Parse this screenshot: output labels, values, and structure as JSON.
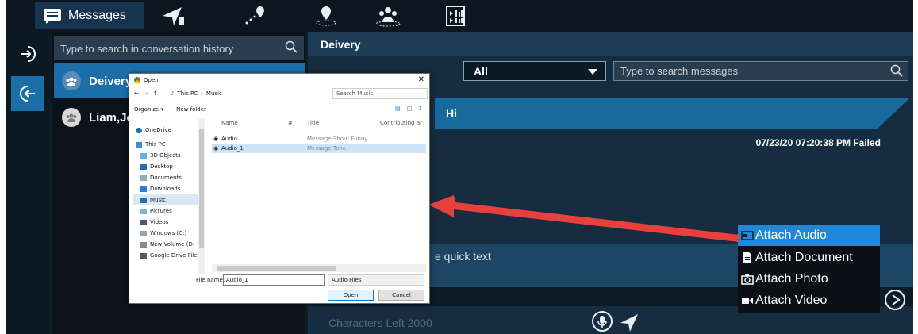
{
  "topbar": {
    "messages_tab_label": "Messages",
    "icons": [
      "message-icon",
      "location-arrow-icon",
      "route-icon",
      "geofence-icon",
      "group-icon",
      "media-icon"
    ]
  },
  "conversations": {
    "search_placeholder": "Type to search in conversation history",
    "items": [
      {
        "label": "Deivery",
        "active": true
      },
      {
        "label": "Liam,Joh",
        "active": false
      }
    ]
  },
  "chat": {
    "title": "Deivery",
    "filter_value": "All",
    "search_placeholder": "Type to search messages",
    "message_text": "Hi",
    "message_status": "07/23/20 07:20:38 PM Failed",
    "quick_text_placeholder": "e quick text",
    "characters_left": "Characters Left 2000"
  },
  "attach_menu": {
    "items": [
      {
        "label": "Attach Audio",
        "icon": "audio-file-icon",
        "active": true
      },
      {
        "label": "Attach Document",
        "icon": "document-icon",
        "active": false
      },
      {
        "label": "Attach Photo",
        "icon": "camera-icon",
        "active": false
      },
      {
        "label": "Attach Video",
        "icon": "video-icon",
        "active": false
      }
    ]
  },
  "dialog": {
    "title": "Open",
    "close": "✕",
    "breadcrumb": [
      "This PC",
      "Music"
    ],
    "search_placeholder": "Search Music",
    "organize_label": "Organize ▾",
    "new_folder_label": "New folder",
    "nav_items": [
      "OneDrive",
      "This PC",
      "3D Objects",
      "Desktop",
      "Documents",
      "Downloads",
      "Music",
      "Pictures",
      "Videos",
      "Windows (C:)",
      "New Volume (D:",
      "Google Drive File"
    ],
    "selected_nav": "Music",
    "columns": [
      "Name",
      "#",
      "Title",
      "Contributing ar"
    ],
    "files": [
      {
        "name": "Audio",
        "title": "Message Shout Funny",
        "selected": false
      },
      {
        "name": "Audio_1",
        "title": "Message Tone",
        "selected": true
      }
    ],
    "file_name_label": "File name:",
    "file_name_value": "Audio_1",
    "file_type": "Audio Files",
    "open_label": "Open",
    "cancel_label": "Cancel"
  },
  "colors": {
    "accent": "#1b6fa8",
    "bubble": "#176b9c",
    "menu_highlight": "#2188d8",
    "annotation_arrow": "#e8413d"
  }
}
